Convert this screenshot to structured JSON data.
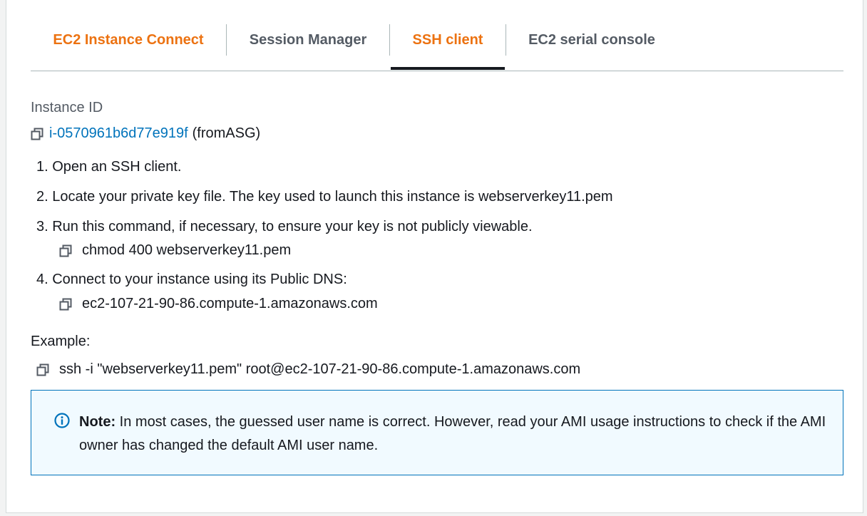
{
  "tabs": [
    {
      "label": "EC2 Instance Connect",
      "active": false
    },
    {
      "label": "Session Manager",
      "active": false
    },
    {
      "label": "SSH client",
      "active": true
    },
    {
      "label": "EC2 serial console",
      "active": false
    }
  ],
  "instance": {
    "label": "Instance ID",
    "id": "i-0570961b6d77e919f",
    "name": "(fromASG)"
  },
  "steps": [
    {
      "text": "1. Open an SSH client."
    },
    {
      "text": "2. Locate your private key file. The key used to launch this instance is webserverkey11.pem"
    },
    {
      "text": "3. Run this command, if necessary, to ensure your key is not publicly viewable.",
      "command": "chmod 400 webserverkey11.pem"
    },
    {
      "text": "4. Connect to your instance using its Public DNS:",
      "command": "ec2-107-21-90-86.compute-1.amazonaws.com"
    }
  ],
  "example": {
    "label": "Example:",
    "command": "ssh -i \"webserverkey11.pem\" root@ec2-107-21-90-86.compute-1.amazonaws.com"
  },
  "note": {
    "title": "Note:",
    "text": " In most cases, the guessed user name is correct. However, read your AMI usage instructions to check if the AMI owner has changed the default AMI user name."
  },
  "colors": {
    "accent_orange": "#ec7211",
    "link_blue": "#0073bb",
    "info_bg": "#f1faff"
  },
  "icons": {
    "copy": "copy-icon",
    "info": "info-icon"
  }
}
